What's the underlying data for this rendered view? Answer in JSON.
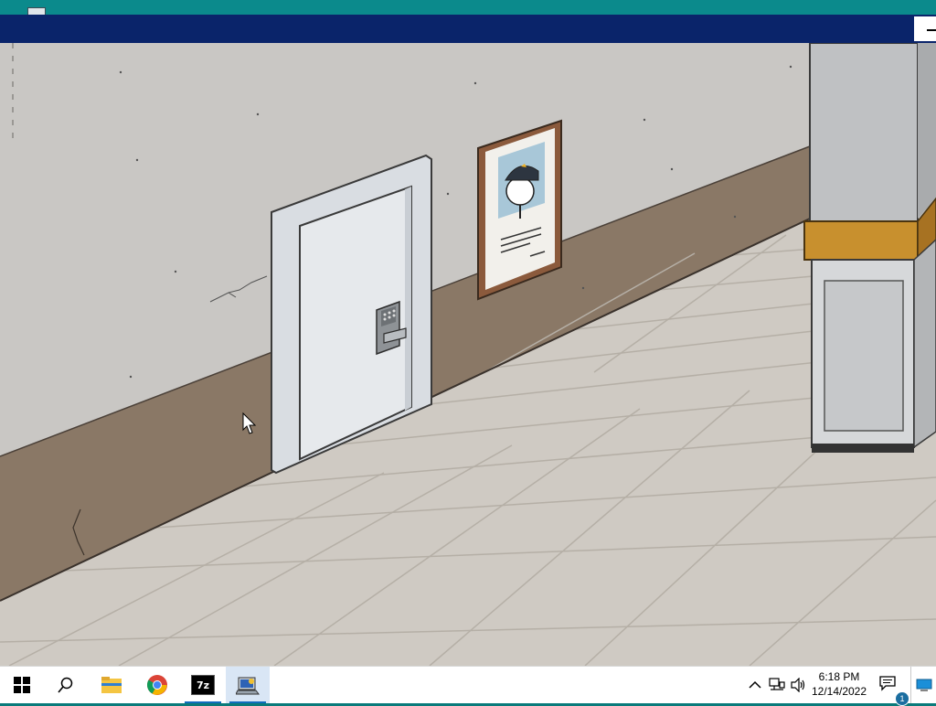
{
  "window": {
    "title": ""
  },
  "game": {
    "colors": {
      "wall": "#c9c7c4",
      "baseboard": "#8a7866",
      "floor": "#cfcac3",
      "door": "#e3e6e9",
      "frame": "#8b5a3c",
      "pillar_trim": "#c8902e"
    },
    "poster": {
      "subject": "wanted-poster-stickman-in-cap"
    }
  },
  "taskbar": {
    "start_icon": "windows-logo-icon",
    "search_icon": "search-icon",
    "apps": [
      {
        "name": "file-explorer-icon",
        "active": false
      },
      {
        "name": "chrome-icon",
        "active": false
      },
      {
        "name": "7zip-icon",
        "label": "7z",
        "active": false
      },
      {
        "name": "game-app-icon",
        "active": true
      }
    ],
    "tray": {
      "chevron": "chevron-up-icon",
      "network": "network-icon",
      "volume": "volume-icon"
    },
    "clock": {
      "time": "6:18 PM",
      "date": "12/14/2022"
    },
    "notifications": {
      "count": "1"
    }
  }
}
